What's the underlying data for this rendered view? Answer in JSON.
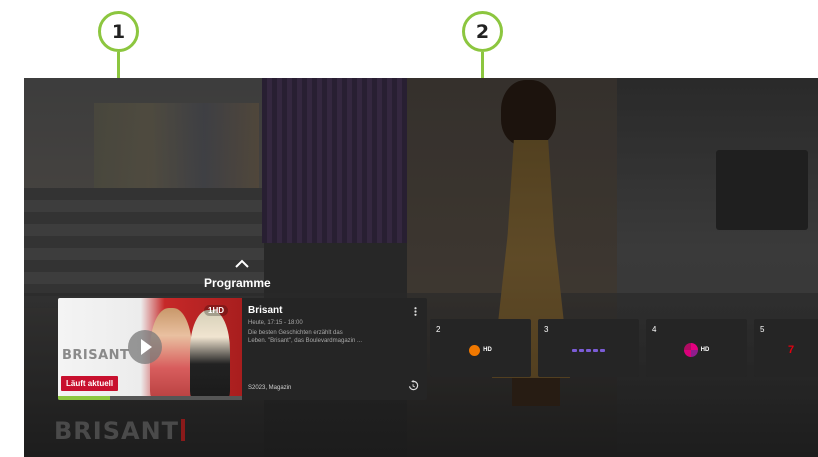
{
  "callouts": [
    {
      "number": "1"
    },
    {
      "number": "2"
    }
  ],
  "tv": {
    "background_logo_text": "BRISANT",
    "menu": {
      "title": "Programme"
    },
    "current_programme": {
      "thumbnail_brand": "BRISANT",
      "channel_logo": "1HD",
      "live_badge": "Läuft aktuell",
      "progress_fraction": 0.28,
      "title": "Brisant",
      "time": "Heute, 17:15 - 18:00",
      "description_line_1": "Die besten Geschichten erzählt das",
      "description_line_2": "Leben. \"Brisant\", das Boulevardmagazin ...",
      "meta": "S2023, Magazin"
    },
    "channels": [
      {
        "number": "2",
        "logo": "HD",
        "logo_name": "zdf-logo",
        "logo_color": "#f07800"
      },
      {
        "number": "3",
        "logo": "",
        "logo_name": "rtl-logo",
        "logo_color": "#7b5cd6"
      },
      {
        "number": "4",
        "logo": "HD",
        "logo_name": "sat1-logo",
        "logo_color": "#e4007f"
      },
      {
        "number": "5",
        "logo": "7",
        "logo_name": "pro7-logo",
        "logo_color": "#e3000f"
      }
    ]
  },
  "colors": {
    "accent_green": "#8cc63f",
    "live_red": "#c8102e",
    "card_bg": "#252525"
  }
}
